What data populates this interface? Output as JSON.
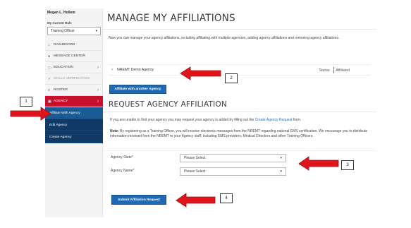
{
  "sidebar": {
    "user_name": "Megan L. Hollem",
    "role_label": "My Current Role",
    "role_value": "Training Officer",
    "items": [
      {
        "icon": "home-icon",
        "glyph": "⌂",
        "label": "DASHBOARD"
      },
      {
        "icon": "chat-icon",
        "glyph": "●",
        "label": "MESSAGE CENTER"
      },
      {
        "icon": "monitor-icon",
        "glyph": "▭",
        "label": "EDUCATION",
        "chevron": "›"
      },
      {
        "icon": "check-icon",
        "glyph": "✓",
        "label": "SKILLS VERIFICATION"
      },
      {
        "icon": "list-icon",
        "glyph": "≡",
        "label": "ROSTER",
        "chevron": "›"
      },
      {
        "icon": "agency-icon",
        "glyph": "▣",
        "label": "AGENCY",
        "chevron": "›"
      }
    ],
    "submenu": [
      "Affiliate With Agency",
      "Edit Agency",
      "Create Agency"
    ]
  },
  "main": {
    "title": "MANAGE MY AFFILIATIONS",
    "intro": "Now you can manage your agency affiliations, including affiliating with multiple agencies, adding agency affiliations and removing agency affiliations.",
    "agency_row": {
      "chevron": "›",
      "name": "NREMT Demo Agency",
      "status_label": "Status:",
      "status_value": "Affiliated"
    },
    "affiliate_button": "Affiliate with another Agency",
    "request_title": "REQUEST AGENCY AFFILIATION",
    "request_text_pre": "If you are unable to find your agency you may request your agency is added by filling out the ",
    "request_link": "Create Agency Request",
    "request_text_post": " form.",
    "note_label": "Note:",
    "note_text": " By registering as a Training Officer, you will receive electronic messages from the NREMT regarding national EMS certification. We encourage you to distribute information received from the NREMT to your Agency staff, including EMS providers, Medical Directors and other Training Officers.",
    "state_label": "Agency State*",
    "state_value": "Please Select",
    "name_label": "Agency Name*",
    "name_value": "Please Select",
    "select_caret": "▾",
    "submit_button": "Submit Affiliation Request"
  },
  "annotations": {
    "callouts": [
      "1",
      "2",
      "3",
      "4"
    ],
    "arrow_color": "#e0141b"
  },
  "colors": {
    "agency_active": "#c8102e",
    "submenu_bg": "#0f3a66",
    "primary_button": "#1f6ab5",
    "status_green": "#3ca546"
  }
}
